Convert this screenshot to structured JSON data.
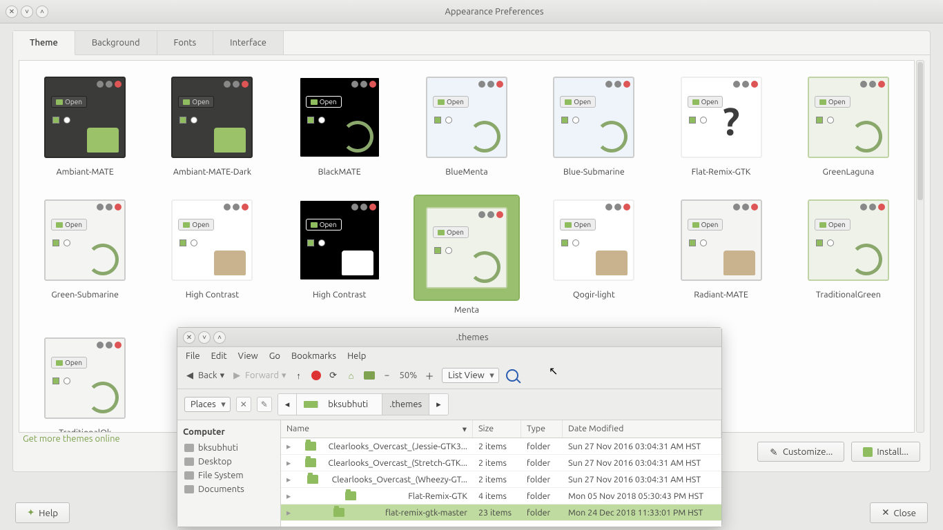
{
  "window": {
    "title": "Appearance Preferences"
  },
  "tabs": [
    {
      "label": "Theme",
      "active": true
    },
    {
      "label": "Background",
      "active": false
    },
    {
      "label": "Fonts",
      "active": false
    },
    {
      "label": "Interface",
      "active": false
    }
  ],
  "open_label": "Open",
  "themes": [
    {
      "name": "Ambiant-MATE",
      "variant": "dark-olive"
    },
    {
      "name": "Ambiant-MATE-Dark",
      "variant": "dark"
    },
    {
      "name": "BlackMATE",
      "variant": "black"
    },
    {
      "name": "BlueMenta",
      "variant": "blue"
    },
    {
      "name": "Blue-Submarine",
      "variant": "blue-sub"
    },
    {
      "name": "Flat-Remix-GTK",
      "variant": "missing"
    },
    {
      "name": "GreenLaguna",
      "variant": "mint"
    },
    {
      "name": "Green-Submarine",
      "variant": "green-sub"
    },
    {
      "name": "High Contrast",
      "variant": "hc-light"
    },
    {
      "name": "High Contrast",
      "variant": "hc-dark"
    },
    {
      "name": "Menta",
      "variant": "menta",
      "selected": true
    },
    {
      "name": "Qogir-light",
      "variant": "white"
    },
    {
      "name": "Radiant-MATE",
      "variant": "radiant"
    },
    {
      "name": "TraditionalGreen",
      "variant": "trad-green"
    },
    {
      "name": "TraditionalOk",
      "variant": "trad-ok"
    }
  ],
  "link_more": "Get more themes online",
  "buttons": {
    "customize": "Customize...",
    "install": "Install...",
    "help": "Help",
    "close": "Close"
  },
  "fm": {
    "title": ".themes",
    "menus": [
      "File",
      "Edit",
      "View",
      "Go",
      "Bookmarks",
      "Help"
    ],
    "toolbar": {
      "back": "Back",
      "forward": "Forward",
      "zoom": "50%",
      "view": "List View"
    },
    "places_label": "Places",
    "breadcrumb": [
      {
        "label": "bksubhuti",
        "icon": "home"
      },
      {
        "label": ".themes",
        "active": true
      }
    ],
    "sidebar": {
      "header": "Computer",
      "items": [
        "bksubhuti",
        "Desktop",
        "File System",
        "Documents"
      ]
    },
    "columns": {
      "name": "Name",
      "size": "Size",
      "type": "Type",
      "date": "Date Modified"
    },
    "rows": [
      {
        "name": "Clearlooks_Overcast_(Jessie-GTK3...",
        "size": "2 items",
        "type": "folder",
        "date": "Sun 27 Nov 2016 03:04:31 AM HST"
      },
      {
        "name": "Clearlooks_Overcast_(Stretch-GTK...",
        "size": "2 items",
        "type": "folder",
        "date": "Sun 27 Nov 2016 03:04:31 AM HST"
      },
      {
        "name": "Clearlooks_Overcast_(Wheezy-GT...",
        "size": "2 items",
        "type": "folder",
        "date": "Sun 27 Nov 2016 03:04:31 AM HST"
      },
      {
        "name": "Flat-Remix-GTK",
        "size": "4 items",
        "type": "folder",
        "date": "Mon 05 Nov 2018 05:30:43 PM HST"
      },
      {
        "name": "flat-remix-gtk-master",
        "size": "23 items",
        "type": "folder",
        "date": "Mon 24 Dec 2018 11:33:01 PM HST",
        "selected": true
      }
    ]
  }
}
